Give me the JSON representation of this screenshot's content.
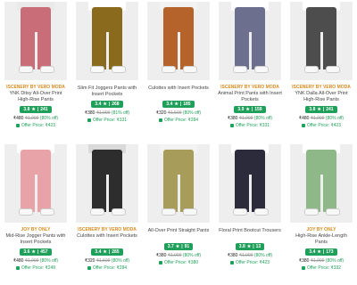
{
  "products": [
    {
      "brand": "ISCENERY BY VERO MODA",
      "title": "YNK Ditsy All-Over Print High-Rise Pants",
      "rating": "3.8",
      "count": "241",
      "price": "₹480",
      "mrp": "₹1,999",
      "off": "(80% off)",
      "offer": "Offer Price: ₹423",
      "colors": {
        "legs": "#c96e78",
        "shirt": "#eaeaea"
      }
    },
    {
      "brand": "",
      "title": "Slim Fit Joggers Pants with Insert Pockets",
      "rating": "3.4",
      "count": "268",
      "price": "₹380",
      "mrp": "₹1,999",
      "off": "(81% off)",
      "offer": "Offer Price: ₹331",
      "colors": {
        "legs": "#8a6a1c",
        "shirt": "#ffffff"
      }
    },
    {
      "brand": "",
      "title": "Culottes with Insert Pockets",
      "rating": "3.4",
      "count": "185",
      "price": "₹320",
      "mrp": "₹1,599",
      "off": "(80% off)",
      "offer": "Offer Price: ₹284",
      "colors": {
        "legs": "#b5622b",
        "shirt": "#f2f2f2"
      }
    },
    {
      "brand": "ISCENERY BY VERO MODA",
      "title": "Animal Print Pants with Insert Pockets",
      "rating": "3.9",
      "count": "159",
      "price": "₹380",
      "mrp": "₹1,999",
      "off": "(80% off)",
      "offer": "Offer Price: ₹331",
      "colors": {
        "legs": "#6d6f8f",
        "shirt": "#ffffff"
      }
    },
    {
      "brand": "ISCENERY BY VERO MODA",
      "title": "YNK Dalla All-Over Print High-Rise Pants",
      "rating": "3.8",
      "count": "241",
      "price": "₹480",
      "mrp": "₹1,999",
      "off": "(80% off)",
      "offer": "Offer Price: ₹423",
      "colors": {
        "legs": "#4d4d4d",
        "shirt": "#ffffff"
      }
    },
    {
      "brand": "JOY BY ONLY",
      "title": "Mid-Rise Jogger Pants with Insert Pockets",
      "rating": "3.6",
      "count": "457",
      "price": "₹480",
      "mrp": "₹1,999",
      "off": "(80% off)",
      "offer": "Offer Price: ₹249",
      "colors": {
        "legs": "#e7a3a8",
        "shirt": "#ffffff"
      }
    },
    {
      "brand": "ISCENERY BY VERO MODA",
      "title": "Culottes with Insert Pockets",
      "rating": "3.4",
      "count": "285",
      "price": "₹320",
      "mrp": "₹1,599",
      "off": "(80% off)",
      "offer": "Offer Price: ₹284",
      "colors": {
        "legs": "#2d2d2d",
        "shirt": "#d9d9d9"
      }
    },
    {
      "brand": "",
      "title": "All-Over Print Straight Pants",
      "rating": "3.7",
      "count": "91",
      "price": "₹380",
      "mrp": "₹1,999",
      "off": "(80% off)",
      "offer": "Offer Price: ₹380",
      "colors": {
        "legs": "#a89c5a",
        "shirt": "#f2f2f2"
      }
    },
    {
      "brand": "",
      "title": "Floral Print Bootcut Trousers",
      "rating": "3.8",
      "count": "13",
      "price": "₹380",
      "mrp": "₹1,999",
      "off": "(80% off)",
      "offer": "Offer Price: ₹423",
      "colors": {
        "legs": "#2b2b3b",
        "shirt": "#ffffff"
      }
    },
    {
      "brand": "JOY BY ONLY",
      "title": "High-Rise Ankle-Length Pants",
      "rating": "3.4",
      "count": "173",
      "price": "₹380",
      "mrp": "₹1,999",
      "off": "(80% off)",
      "offer": "Offer Price: ₹332",
      "colors": {
        "legs": "#8fb889",
        "shirt": "#ffffff"
      }
    }
  ]
}
